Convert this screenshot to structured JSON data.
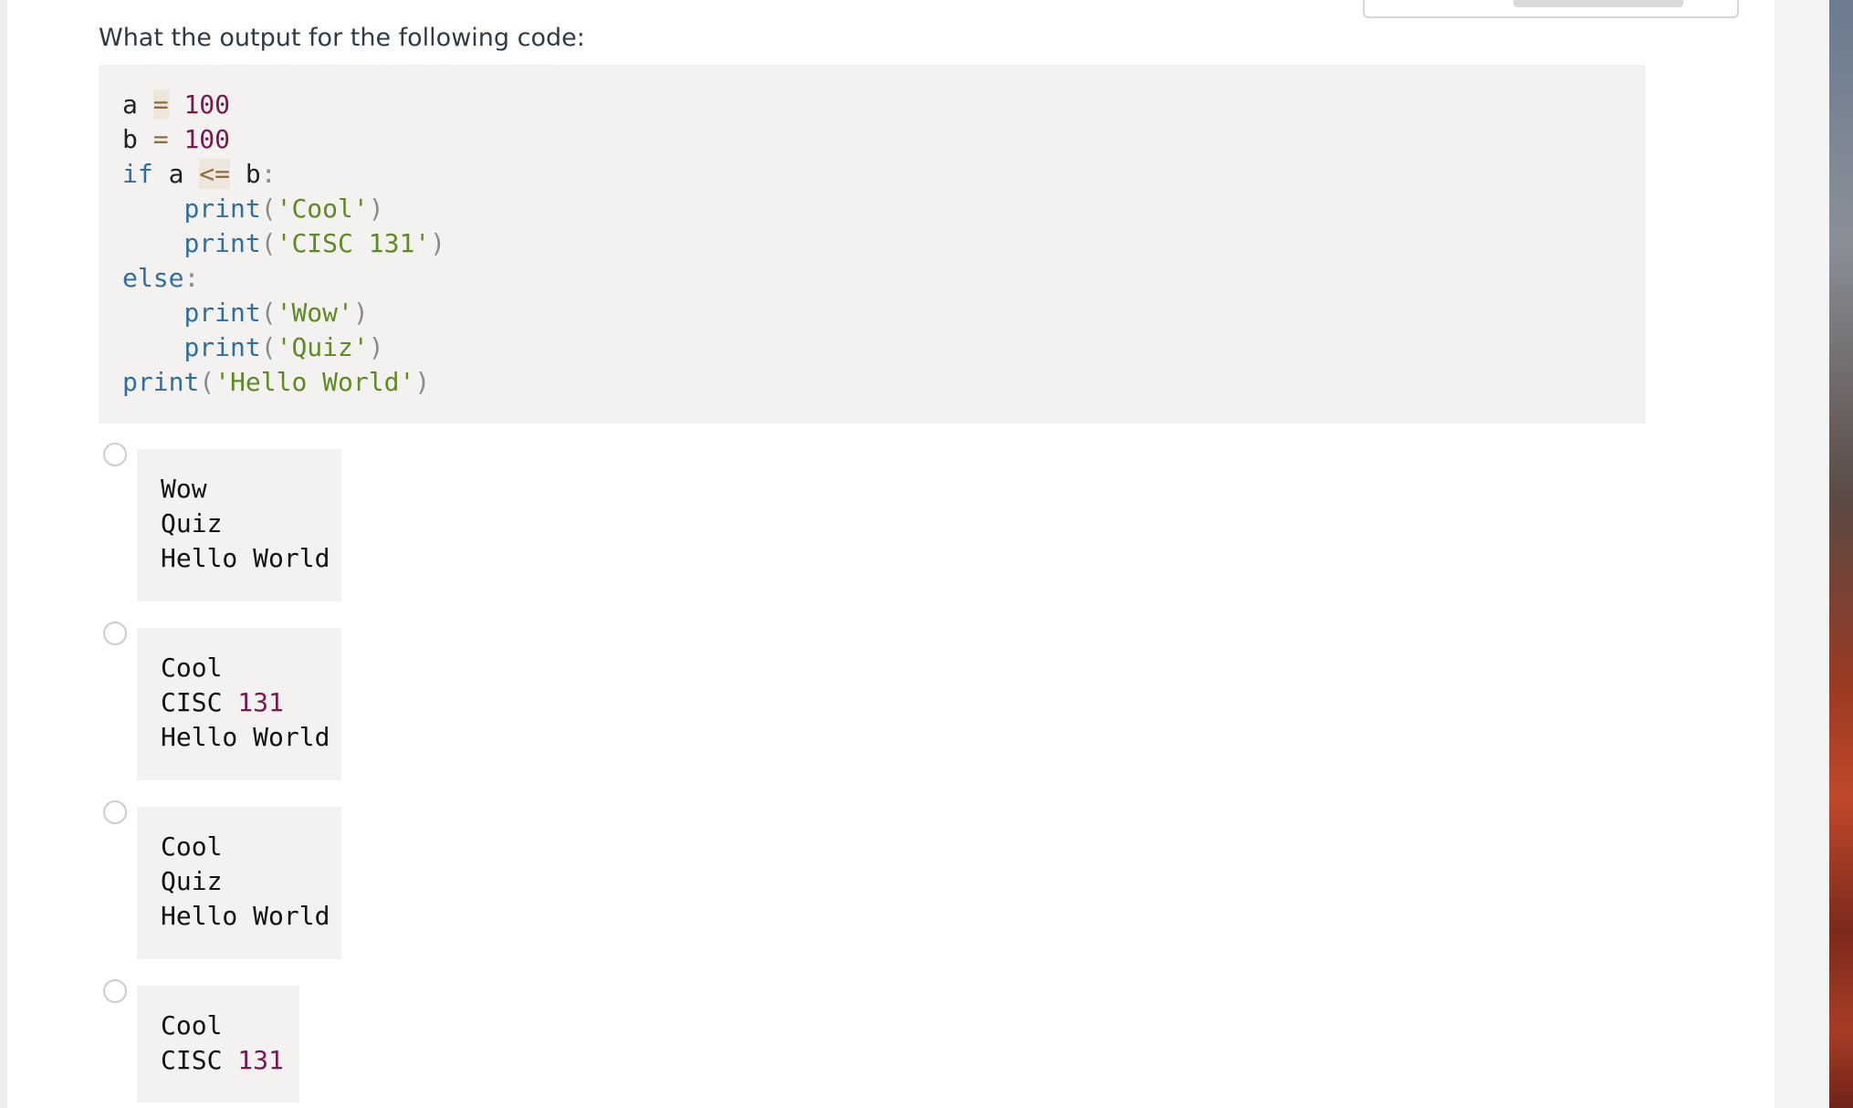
{
  "question": "What the output for the following code:",
  "code": {
    "lines": [
      [
        {
          "t": "a ",
          "c": ""
        },
        {
          "t": "=",
          "c": "op eq"
        },
        {
          "t": " ",
          "c": ""
        },
        {
          "t": "100",
          "c": "num"
        }
      ],
      [
        {
          "t": "b ",
          "c": ""
        },
        {
          "t": "=",
          "c": "op"
        },
        {
          "t": " ",
          "c": ""
        },
        {
          "t": "100",
          "c": "num"
        }
      ],
      [
        {
          "t": "if",
          "c": "kw"
        },
        {
          "t": " a ",
          "c": ""
        },
        {
          "t": "<=",
          "c": "op eq"
        },
        {
          "t": " b",
          "c": ""
        },
        {
          "t": ":",
          "c": "punc"
        }
      ],
      [
        {
          "t": "    ",
          "c": ""
        },
        {
          "t": "print",
          "c": "fn"
        },
        {
          "t": "(",
          "c": "punc"
        },
        {
          "t": "'Cool'",
          "c": "str"
        },
        {
          "t": ")",
          "c": "punc"
        }
      ],
      [
        {
          "t": "    ",
          "c": ""
        },
        {
          "t": "print",
          "c": "fn"
        },
        {
          "t": "(",
          "c": "punc"
        },
        {
          "t": "'CISC 131'",
          "c": "str"
        },
        {
          "t": ")",
          "c": "punc"
        }
      ],
      [
        {
          "t": "else",
          "c": "kw"
        },
        {
          "t": ":",
          "c": "punc"
        }
      ],
      [
        {
          "t": "    ",
          "c": ""
        },
        {
          "t": "print",
          "c": "fn"
        },
        {
          "t": "(",
          "c": "punc"
        },
        {
          "t": "'Wow'",
          "c": "str"
        },
        {
          "t": ")",
          "c": "punc"
        }
      ],
      [
        {
          "t": "    ",
          "c": ""
        },
        {
          "t": "print",
          "c": "fn"
        },
        {
          "t": "(",
          "c": "punc"
        },
        {
          "t": "'Quiz'",
          "c": "str"
        },
        {
          "t": ")",
          "c": "punc"
        }
      ],
      [
        {
          "t": "print",
          "c": "fn"
        },
        {
          "t": "(",
          "c": "punc"
        },
        {
          "t": "'Hello World'",
          "c": "str"
        },
        {
          "t": ")",
          "c": "punc"
        }
      ]
    ]
  },
  "options": [
    {
      "lines": [
        [
          {
            "t": "Wow",
            "c": ""
          }
        ],
        [
          {
            "t": "Quiz",
            "c": ""
          }
        ],
        [
          {
            "t": "Hello World",
            "c": ""
          }
        ]
      ]
    },
    {
      "lines": [
        [
          {
            "t": "Cool",
            "c": ""
          }
        ],
        [
          {
            "t": "CISC ",
            "c": ""
          },
          {
            "t": "131",
            "c": "num"
          }
        ],
        [
          {
            "t": "Hello World",
            "c": ""
          }
        ]
      ]
    },
    {
      "lines": [
        [
          {
            "t": "Cool",
            "c": ""
          }
        ],
        [
          {
            "t": "Quiz",
            "c": ""
          }
        ],
        [
          {
            "t": "Hello World",
            "c": ""
          }
        ]
      ]
    },
    {
      "lines": [
        [
          {
            "t": "Cool",
            "c": ""
          }
        ],
        [
          {
            "t": "CISC ",
            "c": ""
          },
          {
            "t": "131",
            "c": "num"
          }
        ]
      ]
    }
  ]
}
